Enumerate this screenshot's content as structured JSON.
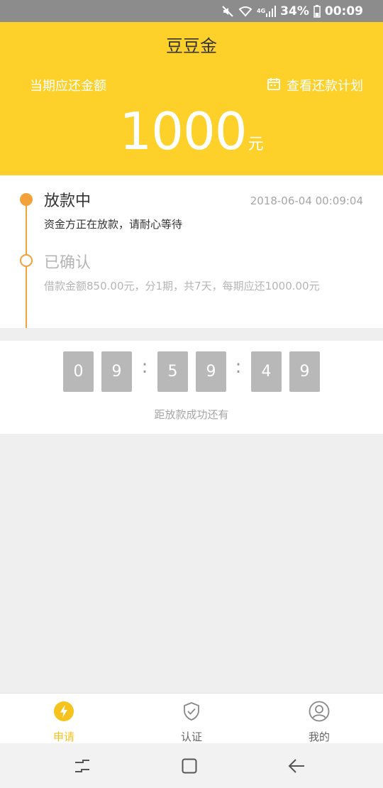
{
  "status_bar": {
    "battery": "34%",
    "time": "00:09",
    "network": "4G",
    "icons": [
      "mute-icon",
      "wifi-icon",
      "signal-icon",
      "battery-icon"
    ]
  },
  "header": {
    "app_title": "豆豆金",
    "due_label": "当期应还金额",
    "plan_link": "查看还款计划",
    "amount": "1000",
    "unit": "元",
    "bg_color": "#fdd02a"
  },
  "timeline": {
    "accent_color": "#f3a13a",
    "steps": [
      {
        "title": "放款中",
        "time": "2018-06-04 00:09:04",
        "desc": "资金方正在放款，请耐心等待"
      },
      {
        "title": "已确认",
        "desc": "借款金额850.00元，分1期，共7天，每期应还1000.00元"
      }
    ]
  },
  "countdown": {
    "digits": [
      "0",
      "9",
      "5",
      "9",
      "4",
      "9"
    ],
    "separator": ":",
    "caption": "距放款成功还有"
  },
  "bottom_nav": {
    "items": [
      {
        "label": "申请",
        "icon": "lightning-icon",
        "active": true
      },
      {
        "label": "认证",
        "icon": "shield-check-icon",
        "active": false
      },
      {
        "label": "我的",
        "icon": "user-icon",
        "active": false
      }
    ],
    "active_color": "#f5c31c"
  },
  "system_bar": {
    "buttons": [
      "recents-icon",
      "home-icon",
      "back-icon"
    ]
  }
}
